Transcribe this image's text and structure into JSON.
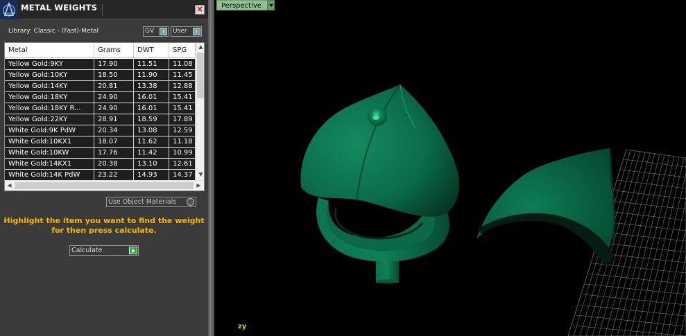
{
  "panel": {
    "title": "METAL WEIGHTS",
    "library_label": "Library: Classic - (Fast)-Metal",
    "gv_toggle": "GV",
    "user_toggle": "User",
    "use_object_materials": "Use Object Materials",
    "instructions_line1": "Highlight the item you want to find the weight",
    "instructions_line2": "for then press calculate.",
    "calculate_label": "Calculate"
  },
  "table": {
    "columns": [
      "Metal",
      "Grams",
      "DWT",
      "SPG"
    ],
    "rows": [
      [
        "Yellow Gold:9KY",
        "17.90",
        "11.51",
        "11.08"
      ],
      [
        "Yellow Gold:10KY",
        "18.50",
        "11.90",
        "11.45"
      ],
      [
        "Yellow Gold:14KY",
        "20.81",
        "13.38",
        "12.88"
      ],
      [
        "Yellow Gold:18KY",
        "24.90",
        "16.01",
        "15.41"
      ],
      [
        "Yellow Gold:18KY R...",
        "24.90",
        "16.01",
        "15.41"
      ],
      [
        "Yellow Gold:22KY",
        "28.91",
        "18.59",
        "17.89"
      ],
      [
        "White Gold:9K PdW",
        "20.34",
        "13.08",
        "12.59"
      ],
      [
        "White Gold:10KX1",
        "18.07",
        "11.62",
        "11.18"
      ],
      [
        "White Gold:10KW",
        "17.76",
        "11.42",
        "10.99"
      ],
      [
        "White Gold:14KX1",
        "20.38",
        "13.10",
        "12.61"
      ],
      [
        "White Gold:14K PdW",
        "23.22",
        "14.93",
        "14.37"
      ]
    ]
  },
  "viewport": {
    "view_label": "Perspective",
    "axis_label": "zy"
  },
  "colors": {
    "panel_bg": "#3b3b3b",
    "accent_yellow": "#f2b800",
    "model_green": "#0b6b4a",
    "viewport_label": "#8fc08f"
  }
}
